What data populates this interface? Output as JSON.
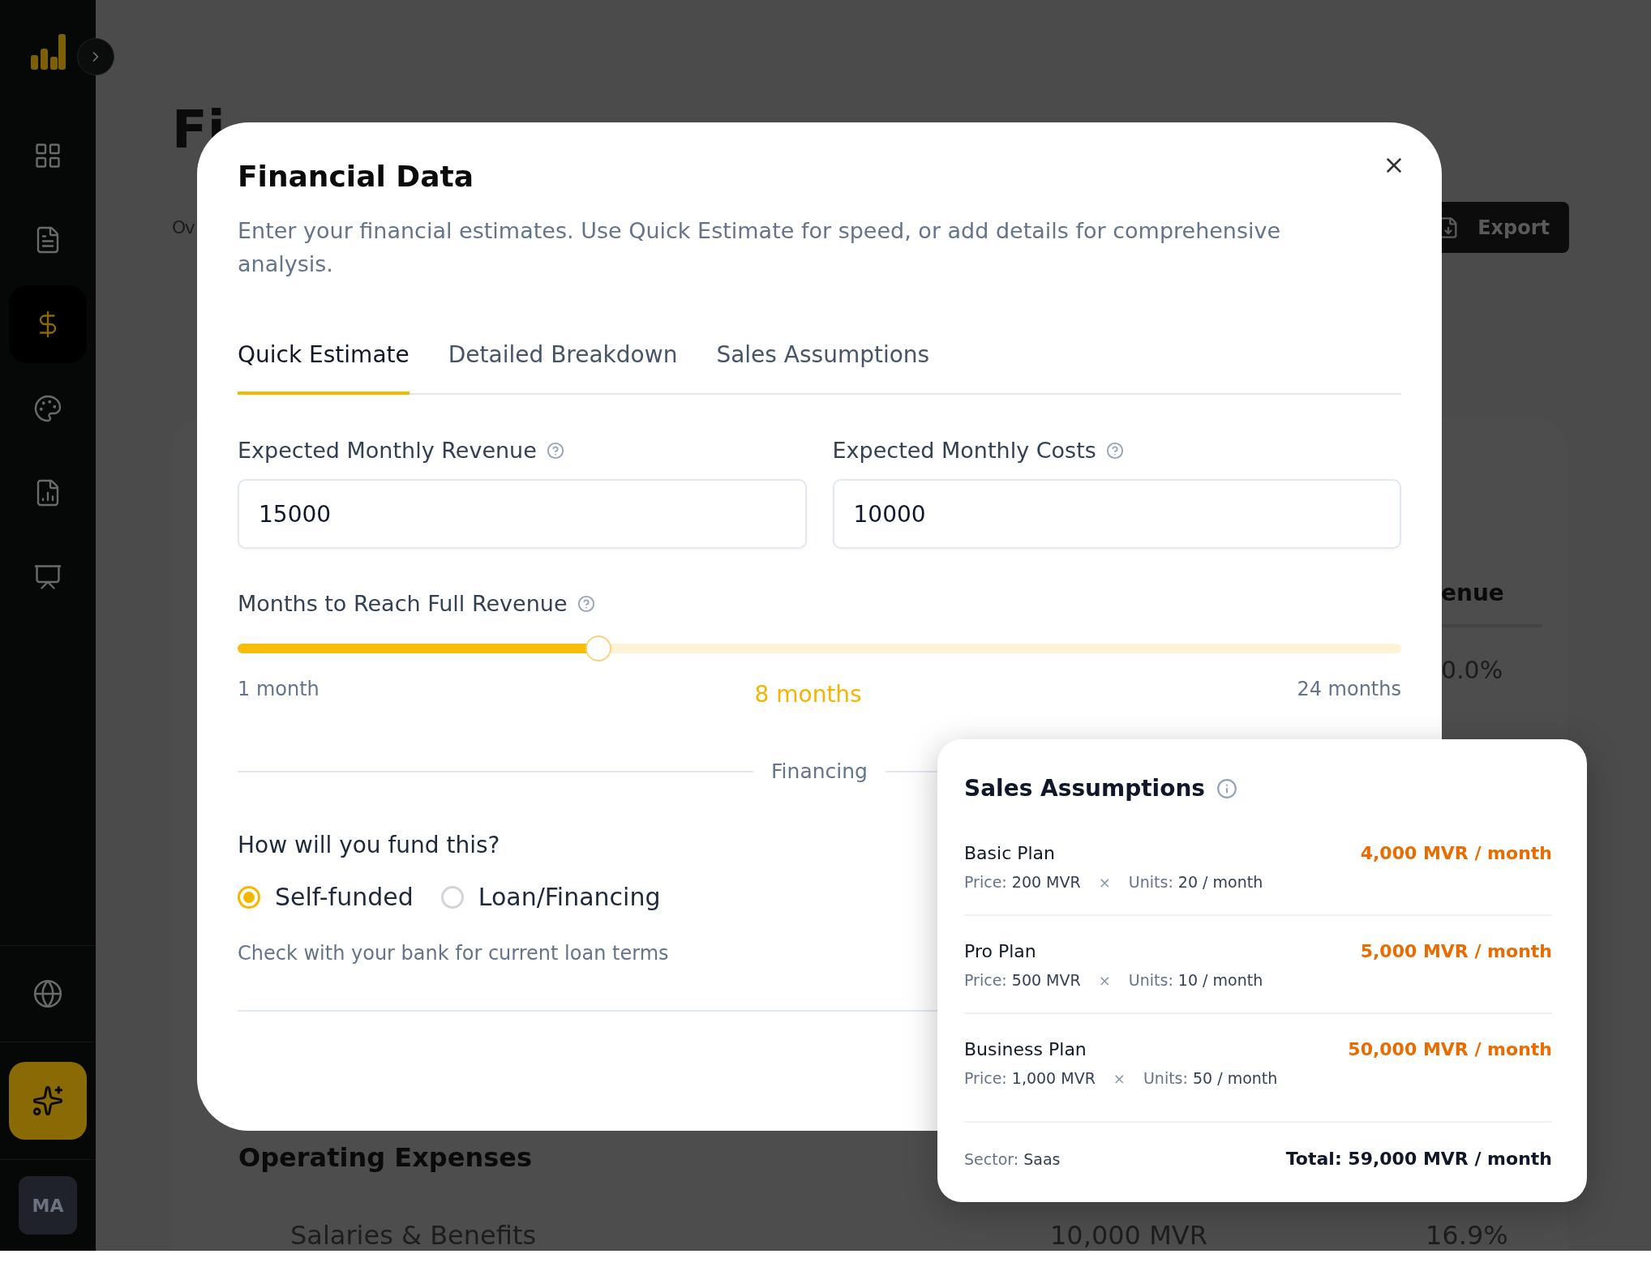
{
  "sidebar": {
    "nav_items": [
      {
        "selected": false
      },
      {
        "selected": false
      },
      {
        "selected": true
      },
      {
        "selected": false
      },
      {
        "selected": false
      },
      {
        "selected": false
      }
    ],
    "avatar": "MA"
  },
  "page": {
    "title_fragment": "Fi",
    "tab_fragment": "Ov",
    "export_button": "Export",
    "column_heading_fragment": "enue",
    "cell_fragment": "0.0%",
    "section_title": "Operating Expenses",
    "expense_row": {
      "name": "Salaries & Benefits",
      "amount": "10,000 MVR",
      "share": "16.9%"
    }
  },
  "dialog": {
    "title": "Financial Data",
    "description": "Enter your financial estimates. Use Quick Estimate for speed, or add details for comprehensive analysis.",
    "tabs": [
      {
        "label": "Quick Estimate",
        "selected": true
      },
      {
        "label": "Detailed Breakdown",
        "selected": false
      },
      {
        "label": "Sales Assumptions",
        "selected": false
      }
    ],
    "fields": [
      {
        "label": "Expected Monthly Revenue",
        "value": "15000"
      },
      {
        "label": "Expected Monthly Costs",
        "value": "10000"
      }
    ],
    "slider": {
      "label": "Months to Reach Full Revenue",
      "level": 0.31,
      "min_label": "1 month",
      "value_label": "8 months",
      "max_label": "24 months"
    },
    "divider_label": "Financing",
    "funding": {
      "question": "How will you fund this?",
      "options": [
        {
          "label": "Self-funded",
          "selected": true
        },
        {
          "label": "Loan/Financing",
          "selected": false
        }
      ],
      "note": "Check with your bank for current loan terms"
    }
  },
  "sales_card": {
    "title": "Sales Assumptions",
    "plans": [
      {
        "name": "Basic Plan",
        "price_label": "Price:",
        "price": "200 MVR",
        "separator": "×",
        "units_label": "Units:",
        "units": "20 / month",
        "total": "4,000 MVR / month"
      },
      {
        "name": "Pro Plan",
        "price_label": "Price:",
        "price": "500 MVR",
        "separator": "×",
        "units_label": "Units:",
        "units": "10 / month",
        "total": "5,000 MVR / month"
      },
      {
        "name": "Business Plan",
        "price_label": "Price:",
        "price": "1,000 MVR",
        "separator": "×",
        "units_label": "Units:",
        "units": "50 / month",
        "total": "50,000 MVR / month"
      }
    ],
    "sector_label": "Sector:",
    "sector": "Saas",
    "total": "Total: 59,000 MVR / month"
  }
}
